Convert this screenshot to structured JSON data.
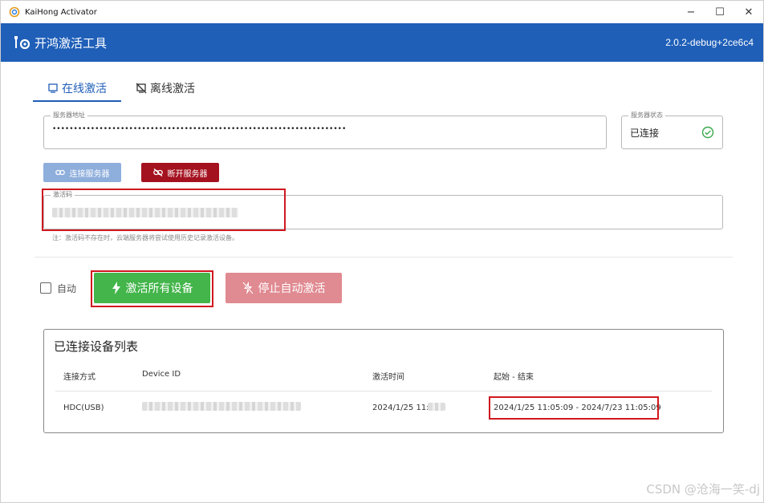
{
  "window": {
    "title": "KaiHong Activator",
    "minimize": "−",
    "maximize": "☐",
    "close": "✕"
  },
  "header": {
    "title": "开鸿激活工具",
    "version": "2.0.2-debug+2ce6c4"
  },
  "tabs": [
    {
      "label": "在线激活",
      "active": true
    },
    {
      "label": "离线激活",
      "active": false
    }
  ],
  "server": {
    "address_label": "服务器地址",
    "address_value": "•••••••••••••••••••••••••••••••••••••••••••••••••••••••••••••••••••••",
    "status_label": "服务器状态",
    "status_value": "已连接",
    "connect_button": "连接服务器",
    "disconnect_button": "断开服务器"
  },
  "activation": {
    "code_label": "激活码",
    "note": "注：激活码不存在时，云端服务器将尝试使用历史记录激活设备。",
    "auto_label": "自动",
    "activate_all_button": "激活所有设备",
    "stop_auto_button": "停止自动激活"
  },
  "device_list": {
    "title": "已连接设备列表",
    "columns": [
      "连接方式",
      "Device ID",
      "激活时间",
      "起始 - 结束"
    ],
    "rows": [
      {
        "connection": "HDC(USB)",
        "device_id": "",
        "activated_at": "2024/1/25 11:",
        "range": "2024/1/25 11:05:09 - 2024/7/23 11:05:09"
      }
    ]
  },
  "watermark": "CSDN @沧海一笑-dj",
  "colors": {
    "brand_blue": "#1f5fb8",
    "connect_disabled": "#8eaedc",
    "disconnect_red": "#a5121f",
    "activate_green": "#43b54a",
    "stop_pink": "#e08a91",
    "ok_green": "#3aa84c",
    "annotation_red": "#d0181f"
  }
}
